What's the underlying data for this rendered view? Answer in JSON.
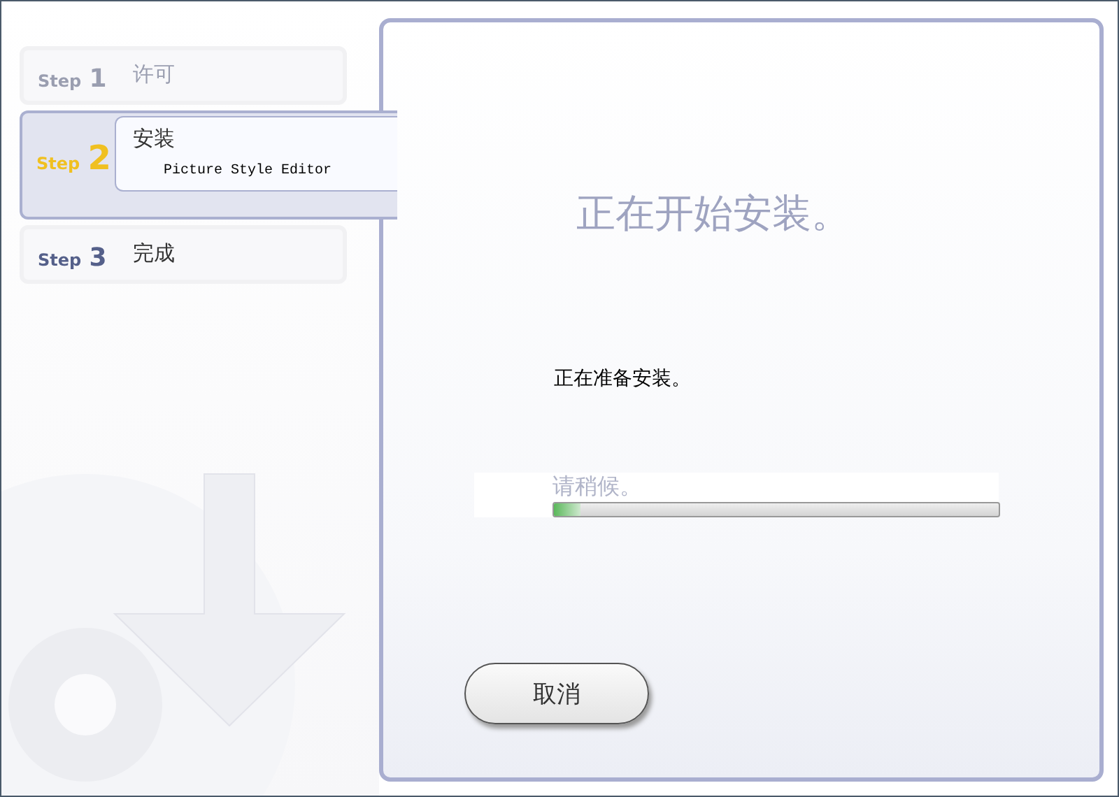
{
  "steps": [
    {
      "step_label": "Step",
      "number": "1",
      "title": "许可",
      "selected": false,
      "dimmed": true
    },
    {
      "step_label": "Step",
      "number": "2",
      "title": "安装",
      "subtitle": "Picture Style Editor",
      "selected": true,
      "dimmed": false
    },
    {
      "step_label": "Step",
      "number": "3",
      "title": "完成",
      "selected": false,
      "dimmed": false
    }
  ],
  "panel": {
    "heading": "正在开始安装。",
    "status": "正在准备安装。",
    "wait_text": "请稍候。",
    "progress": {
      "level": 0.06
    },
    "cancel_button": "取消"
  }
}
